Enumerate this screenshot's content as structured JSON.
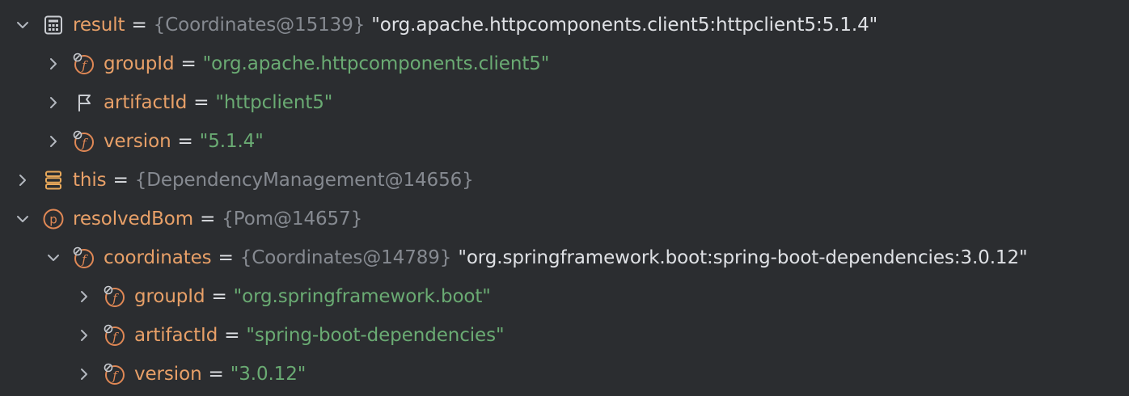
{
  "tree": {
    "rows": [
      {
        "expanded": true,
        "icon": "calculator-icon",
        "name": "result",
        "eq": "=",
        "type": "{Coordinates@15139}",
        "value": "\"org.apache.httpcomponents.client5:httpclient5:5.1.4\"",
        "value_kind": "plain"
      },
      {
        "expanded": false,
        "icon": "final-field-icon",
        "name": "groupId",
        "eq": "=",
        "type": "",
        "value": "\"org.apache.httpcomponents.client5\"",
        "value_kind": "string"
      },
      {
        "expanded": false,
        "icon": "flag-icon",
        "name": "artifactId",
        "eq": "=",
        "type": "",
        "value": "\"httpclient5\"",
        "value_kind": "string"
      },
      {
        "expanded": false,
        "icon": "final-field-icon",
        "name": "version",
        "eq": "=",
        "type": "",
        "value": "\"5.1.4\"",
        "value_kind": "string"
      },
      {
        "expanded": false,
        "icon": "stack-icon",
        "name": "this",
        "eq": "=",
        "type": "{DependencyManagement@14656}",
        "value": "",
        "value_kind": "plain"
      },
      {
        "expanded": true,
        "icon": "property-icon",
        "name": "resolvedBom",
        "eq": "=",
        "type": "{Pom@14657}",
        "value": "",
        "value_kind": "plain"
      },
      {
        "expanded": true,
        "icon": "final-field-icon",
        "name": "coordinates",
        "eq": "=",
        "type": "{Coordinates@14789}",
        "value": "\"org.springframework.boot:spring-boot-dependencies:3.0.12\"",
        "value_kind": "plain"
      },
      {
        "expanded": false,
        "icon": "final-field-icon",
        "name": "groupId",
        "eq": "=",
        "type": "",
        "value": "\"org.springframework.boot\"",
        "value_kind": "string"
      },
      {
        "expanded": false,
        "icon": "final-field-icon",
        "name": "artifactId",
        "eq": "=",
        "type": "",
        "value": "\"spring-boot-dependencies\"",
        "value_kind": "string"
      },
      {
        "expanded": false,
        "icon": "final-field-icon",
        "name": "version",
        "eq": "=",
        "type": "",
        "value": "\"3.0.12\"",
        "value_kind": "string"
      }
    ]
  },
  "colors": {
    "background": "#2b2d30",
    "name": "#e8a068",
    "type": "#868a91",
    "string": "#6aab73",
    "text": "#dfe1e5",
    "icon_orange": "#e08855"
  }
}
